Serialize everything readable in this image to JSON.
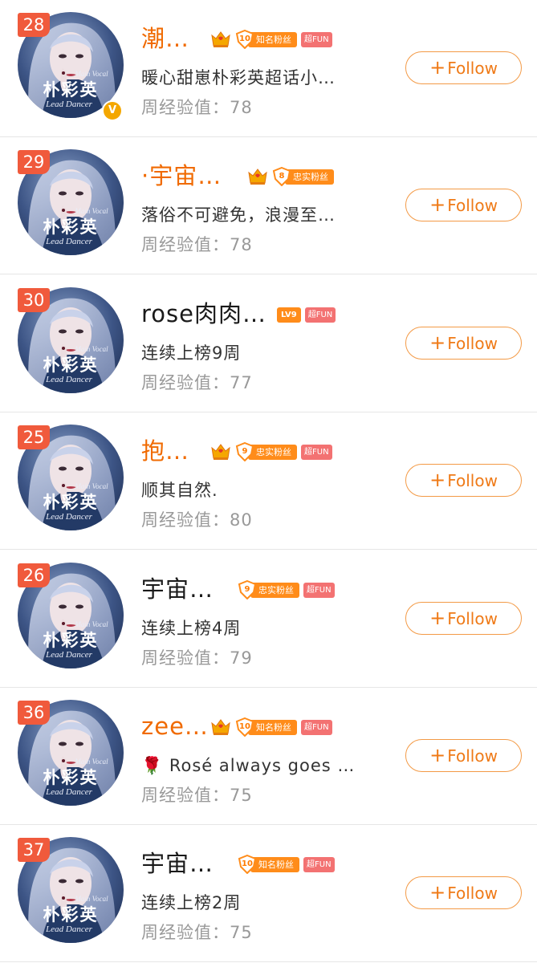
{
  "score_label": "周经验值：",
  "follow_label": "Follow",
  "rows": [
    {
      "rank": "28",
      "name": "潮…",
      "name_orange": true,
      "verified": true,
      "desc": "暖心甜崽朴彩英超话小…",
      "score": "78",
      "badges": [
        {
          "type": "crown"
        },
        {
          "type": "fan",
          "level": "10",
          "text": "知名粉丝"
        },
        {
          "type": "fun",
          "text": "超FUN"
        }
      ]
    },
    {
      "rank": "29",
      "name": "·宇宙…",
      "name_orange": true,
      "verified": false,
      "desc": "落俗不可避免，浪漫至…",
      "score": "78",
      "badges": [
        {
          "type": "crown"
        },
        {
          "type": "fan",
          "level": "8",
          "text": "忠实粉丝"
        }
      ]
    },
    {
      "rank": "30",
      "name": "rose肉肉…",
      "name_orange": false,
      "verified": false,
      "desc": "连续上榜9周",
      "score": "77",
      "badges": [
        {
          "type": "lv",
          "text": "LV9"
        },
        {
          "type": "fun",
          "text": "超FUN"
        }
      ]
    },
    {
      "rank": "25",
      "name": "抱…",
      "name_orange": true,
      "verified": false,
      "desc": "顺其自然.",
      "score": "80",
      "badges": [
        {
          "type": "crown"
        },
        {
          "type": "fan",
          "level": "9",
          "text": "忠实粉丝"
        },
        {
          "type": "fun",
          "text": "超FUN"
        }
      ]
    },
    {
      "rank": "26",
      "name": "宇宙…",
      "name_orange": false,
      "verified": false,
      "desc": "连续上榜4周",
      "score": "79",
      "badges": [
        {
          "type": "fan",
          "level": "9",
          "text": "忠实粉丝"
        },
        {
          "type": "fun",
          "text": "超FUN"
        }
      ]
    },
    {
      "rank": "36",
      "name": "zee…",
      "name_orange": true,
      "verified": false,
      "desc": "🌹 Rosé always goes …",
      "score": "75",
      "badges": [
        {
          "type": "crown"
        },
        {
          "type": "fan",
          "level": "10",
          "text": "知名粉丝"
        },
        {
          "type": "fun",
          "text": "超FUN"
        }
      ]
    },
    {
      "rank": "37",
      "name": "宇宙…",
      "name_orange": false,
      "verified": false,
      "desc": "连续上榜2周",
      "score": "75",
      "badges": [
        {
          "type": "fan",
          "level": "10",
          "text": "知名粉丝"
        },
        {
          "type": "fun",
          "text": "超FUN"
        }
      ]
    }
  ],
  "avatar_text": {
    "line1": "Main Vocal",
    "line2": "朴彩英",
    "line3": "Lead Dancer"
  },
  "verified_mark": "V",
  "colors": {
    "accent": "#ef7a17",
    "rank_bg": "#f05a3c",
    "fan_badge": "#ff8c1a",
    "fun_badge": "#f37272",
    "name_orange": "#f06a00"
  }
}
